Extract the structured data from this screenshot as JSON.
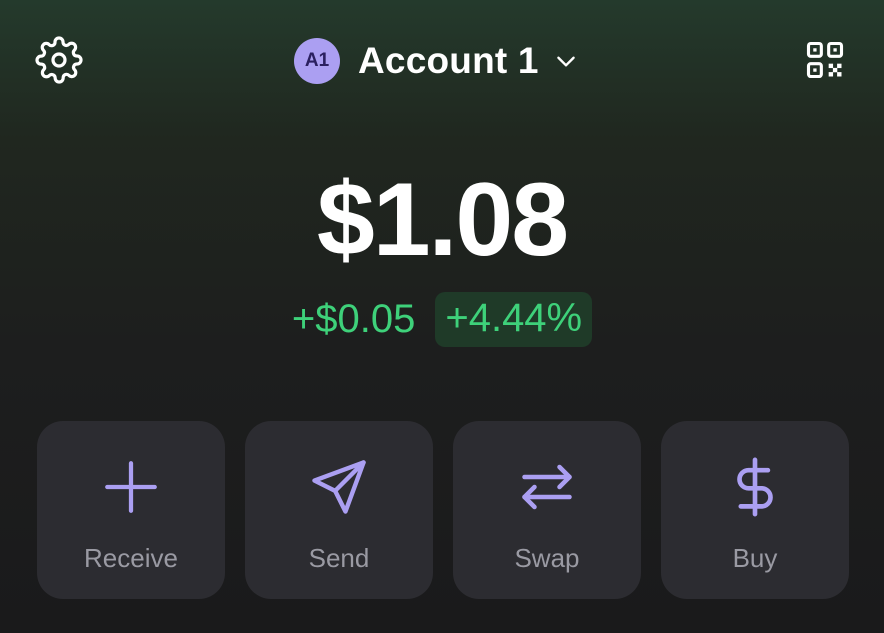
{
  "header": {
    "avatar_initials": "A1",
    "account_name": "Account 1",
    "avatar_color": "#ab9ff2",
    "icons": [
      "gear-icon",
      "chevron-down-icon",
      "qr-code-icon"
    ]
  },
  "portfolio": {
    "balance": "$1.08",
    "change_value": "+$0.05",
    "change_percent": "+4.44%",
    "positive_color": "#3ed17a"
  },
  "actions": [
    {
      "label": "Receive",
      "icon": "plus-icon"
    },
    {
      "label": "Send",
      "icon": "send-icon"
    },
    {
      "label": "Swap",
      "icon": "swap-arrows-icon"
    },
    {
      "label": "Buy",
      "icon": "dollar-icon"
    }
  ],
  "accent_color": "#ab9ff2"
}
